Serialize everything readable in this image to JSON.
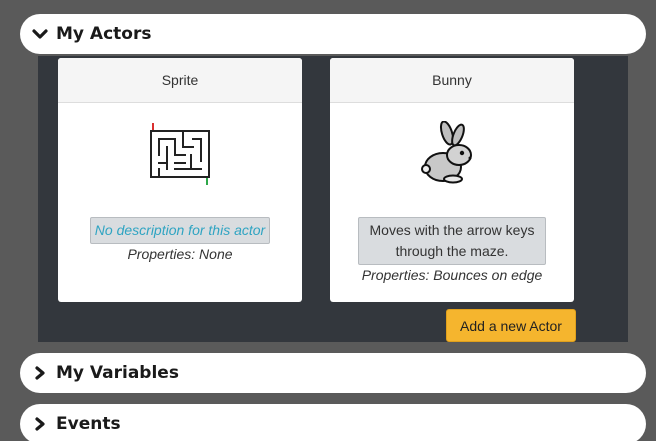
{
  "sections": {
    "actors": {
      "title": "My Actors",
      "expanded": true
    },
    "variables": {
      "title": "My Variables",
      "expanded": false
    },
    "events": {
      "title": "Events",
      "expanded": false
    }
  },
  "actors": [
    {
      "name": "Sprite",
      "image_icon": "maze-icon",
      "description": "No description for this actor",
      "description_is_placeholder": true,
      "properties": "Properties: None"
    },
    {
      "name": "Bunny",
      "image_icon": "bunny-icon",
      "description": "Moves with the arrow keys through the maze.",
      "description_is_placeholder": false,
      "properties": "Properties: Bounces on edge"
    }
  ],
  "add_actor_label": "Add a new Actor",
  "colors": {
    "background": "#5a5a5a",
    "panel": "#33373d",
    "accent_button": "#f5b52e",
    "placeholder_text": "#2fa4c2"
  }
}
